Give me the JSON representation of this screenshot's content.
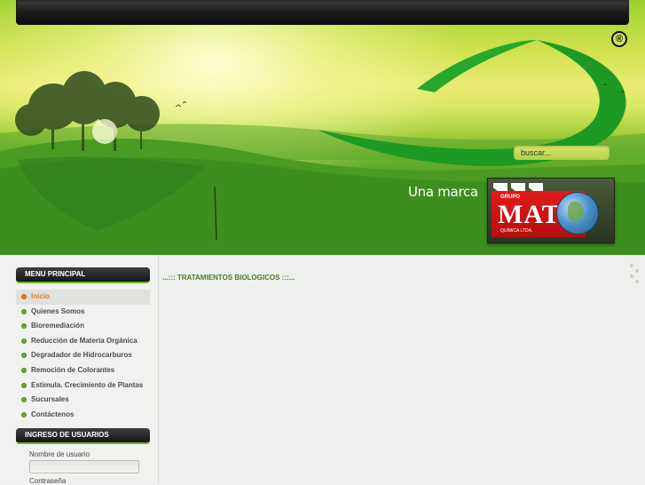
{
  "header": {
    "registered_symbol": "®",
    "search": {
      "placeholder": "buscar..."
    },
    "tagline": "Una marca",
    "logo": {
      "grupo": "GRUPO",
      "name": "MAT",
      "subtitle": "QUÍMICA LTDA."
    }
  },
  "sidebar": {
    "menu_title": "MENU PRINCIPAL",
    "menu_items": [
      {
        "label": "Inicio",
        "active": true
      },
      {
        "label": "Quienes Somos",
        "active": false
      },
      {
        "label": "Bioremediación",
        "active": false
      },
      {
        "label": "Reducción de Materia Orgánica",
        "active": false
      },
      {
        "label": "Degradador de Hidrocarburos",
        "active": false
      },
      {
        "label": "Remoción de Colorantes",
        "active": false
      },
      {
        "label": "Estimula. Crecimiento de Plantas",
        "active": false
      },
      {
        "label": "Sucursales",
        "active": false
      },
      {
        "label": "Contáctenos",
        "active": false
      }
    ],
    "login_title": "INGRESO DE USUARIOS",
    "username_label": "Nombre de usuario",
    "password_label": "Contraseña"
  },
  "main": {
    "page_title": "...::: TRATAMIENTOS BIOLOGICOS :::..."
  },
  "colors": {
    "accent_green": "#6db332",
    "active_orange": "#e87b1a",
    "logo_red": "#d61414"
  }
}
